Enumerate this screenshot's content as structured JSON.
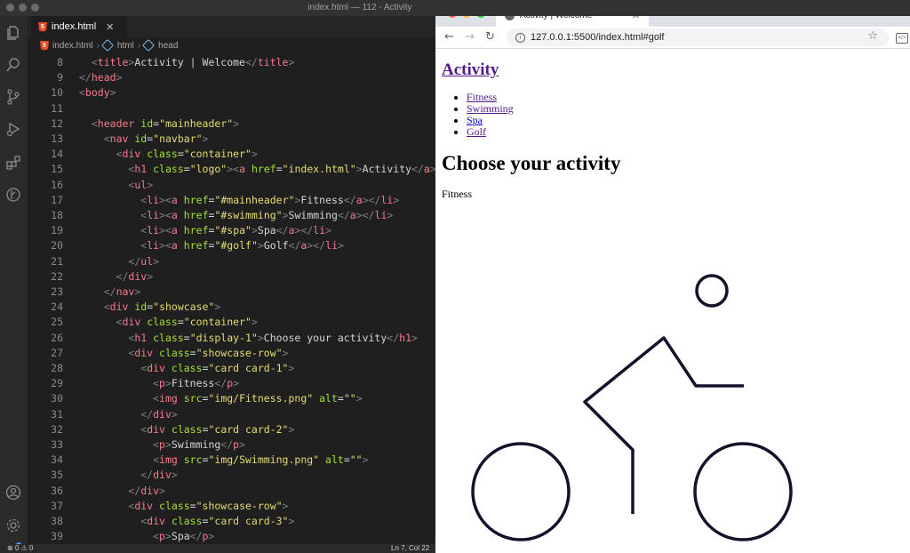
{
  "window": {
    "title": "index.html — 112 - Activity"
  },
  "editor": {
    "tab_label": "index.html",
    "breadcrumb": [
      "index.html",
      "html",
      "head"
    ],
    "lines": [
      {
        "n": "8",
        "t": "  <title>Activity | Welcome</title>"
      },
      {
        "n": "9",
        "t": "</head>"
      },
      {
        "n": "10",
        "t": "<body>"
      },
      {
        "n": "11",
        "t": ""
      },
      {
        "n": "12",
        "t": "  <header id=\"mainheader\">"
      },
      {
        "n": "13",
        "t": "    <nav id=\"navbar\">"
      },
      {
        "n": "14",
        "t": "      <div class=\"container\">"
      },
      {
        "n": "15",
        "t": "        <h1 class=\"logo\"><a href=\"index.html\">Activity</a>"
      },
      {
        "n": "16",
        "t": "        <ul>"
      },
      {
        "n": "17",
        "t": "          <li><a href=\"#mainheader\">Fitness</a></li>"
      },
      {
        "n": "18",
        "t": "          <li><a href=\"#swimming\">Swimming</a></li>"
      },
      {
        "n": "19",
        "t": "          <li><a href=\"#spa\">Spa</a></li>"
      },
      {
        "n": "20",
        "t": "          <li><a href=\"#golf\">Golf</a></li>"
      },
      {
        "n": "21",
        "t": "        </ul>"
      },
      {
        "n": "22",
        "t": "      </div>"
      },
      {
        "n": "23",
        "t": "    </nav>"
      },
      {
        "n": "24",
        "t": "    <div id=\"showcase\">"
      },
      {
        "n": "25",
        "t": "      <div class=\"container\">"
      },
      {
        "n": "26",
        "t": "        <h1 class=\"display-1\">Choose your activity</h1>"
      },
      {
        "n": "27",
        "t": "        <div class=\"showcase-row\">"
      },
      {
        "n": "28",
        "t": "          <div class=\"card card-1\">"
      },
      {
        "n": "29",
        "t": "            <p>Fitness</p>"
      },
      {
        "n": "30",
        "t": "            <img src=\"img/Fitness.png\" alt=\"\">"
      },
      {
        "n": "31",
        "t": "          </div>"
      },
      {
        "n": "32",
        "t": "          <div class=\"card card-2\">"
      },
      {
        "n": "33",
        "t": "            <p>Swimming</p>"
      },
      {
        "n": "34",
        "t": "            <img src=\"img/Swimming.png\" alt=\"\">"
      },
      {
        "n": "35",
        "t": "          </div>"
      },
      {
        "n": "36",
        "t": "        </div>"
      },
      {
        "n": "37",
        "t": "        <div class=\"showcase-row\">"
      },
      {
        "n": "38",
        "t": "          <div class=\"card card-3\">"
      },
      {
        "n": "39",
        "t": "            <p>Spa</p>"
      }
    ],
    "status": {
      "problems": "0",
      "warnings": "0",
      "cursor": "Ln 7, Col 22"
    },
    "badge_count": "1"
  },
  "browser": {
    "tab_title": "Activity | Welcome",
    "url": "127.0.0.1:5500/index.html#golf",
    "page": {
      "logo": "Activity",
      "nav": [
        "Fitness",
        "Swimming",
        "Spa",
        "Golf"
      ],
      "heading": "Choose your activity",
      "card_label": "Fitness"
    }
  },
  "colors": {
    "tag": "#f47c8c",
    "attr": "#a6e22e",
    "string": "#e6db74",
    "text": "#d4d4d4",
    "visited_link": "#551a8b",
    "link": "#0000ee"
  }
}
